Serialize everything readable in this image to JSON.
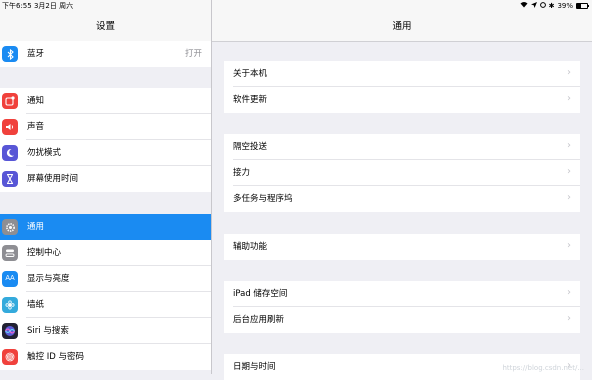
{
  "status": {
    "time_date": "下午6:55  3月2日 周六",
    "battery": "39%",
    "battery_level": 0.39
  },
  "left": {
    "title": "设置",
    "items": [
      {
        "label": "蓝牙",
        "value": "打开",
        "icon": "bluetooth-icon",
        "color": "#1a8bf2"
      },
      {
        "label": "通知",
        "icon": "notifications-icon",
        "color": "#f0413c"
      },
      {
        "label": "声音",
        "icon": "sound-icon",
        "color": "#f0413c"
      },
      {
        "label": "勿扰模式",
        "icon": "moon-icon",
        "color": "#5856d6"
      },
      {
        "label": "屏幕使用时间",
        "icon": "hourglass-icon",
        "color": "#5856d6"
      },
      {
        "label": "通用",
        "icon": "gear-icon",
        "color": "#8e8e93",
        "selected": true
      },
      {
        "label": "控制中心",
        "icon": "control-center-icon",
        "color": "#8e8e93"
      },
      {
        "label": "显示与亮度",
        "icon": "display-icon",
        "color": "#1a8bf2"
      },
      {
        "label": "墙纸",
        "icon": "wallpaper-icon",
        "color": "#34aadc"
      },
      {
        "label": "Siri 与搜索",
        "icon": "siri-icon",
        "color": "#222233"
      },
      {
        "label": "触控 ID 与密码",
        "icon": "fingerprint-icon",
        "color": "#f0413c"
      }
    ]
  },
  "right": {
    "title": "通用",
    "groups": [
      [
        "关于本机",
        "软件更新"
      ],
      [
        "隔空投送",
        "接力",
        "多任务与程序坞"
      ],
      [
        "辅助功能"
      ],
      [
        "iPad 储存空间",
        "后台应用刷新"
      ],
      [
        "日期与时间"
      ]
    ]
  },
  "watermark": "https://blog.csdn.net/..."
}
